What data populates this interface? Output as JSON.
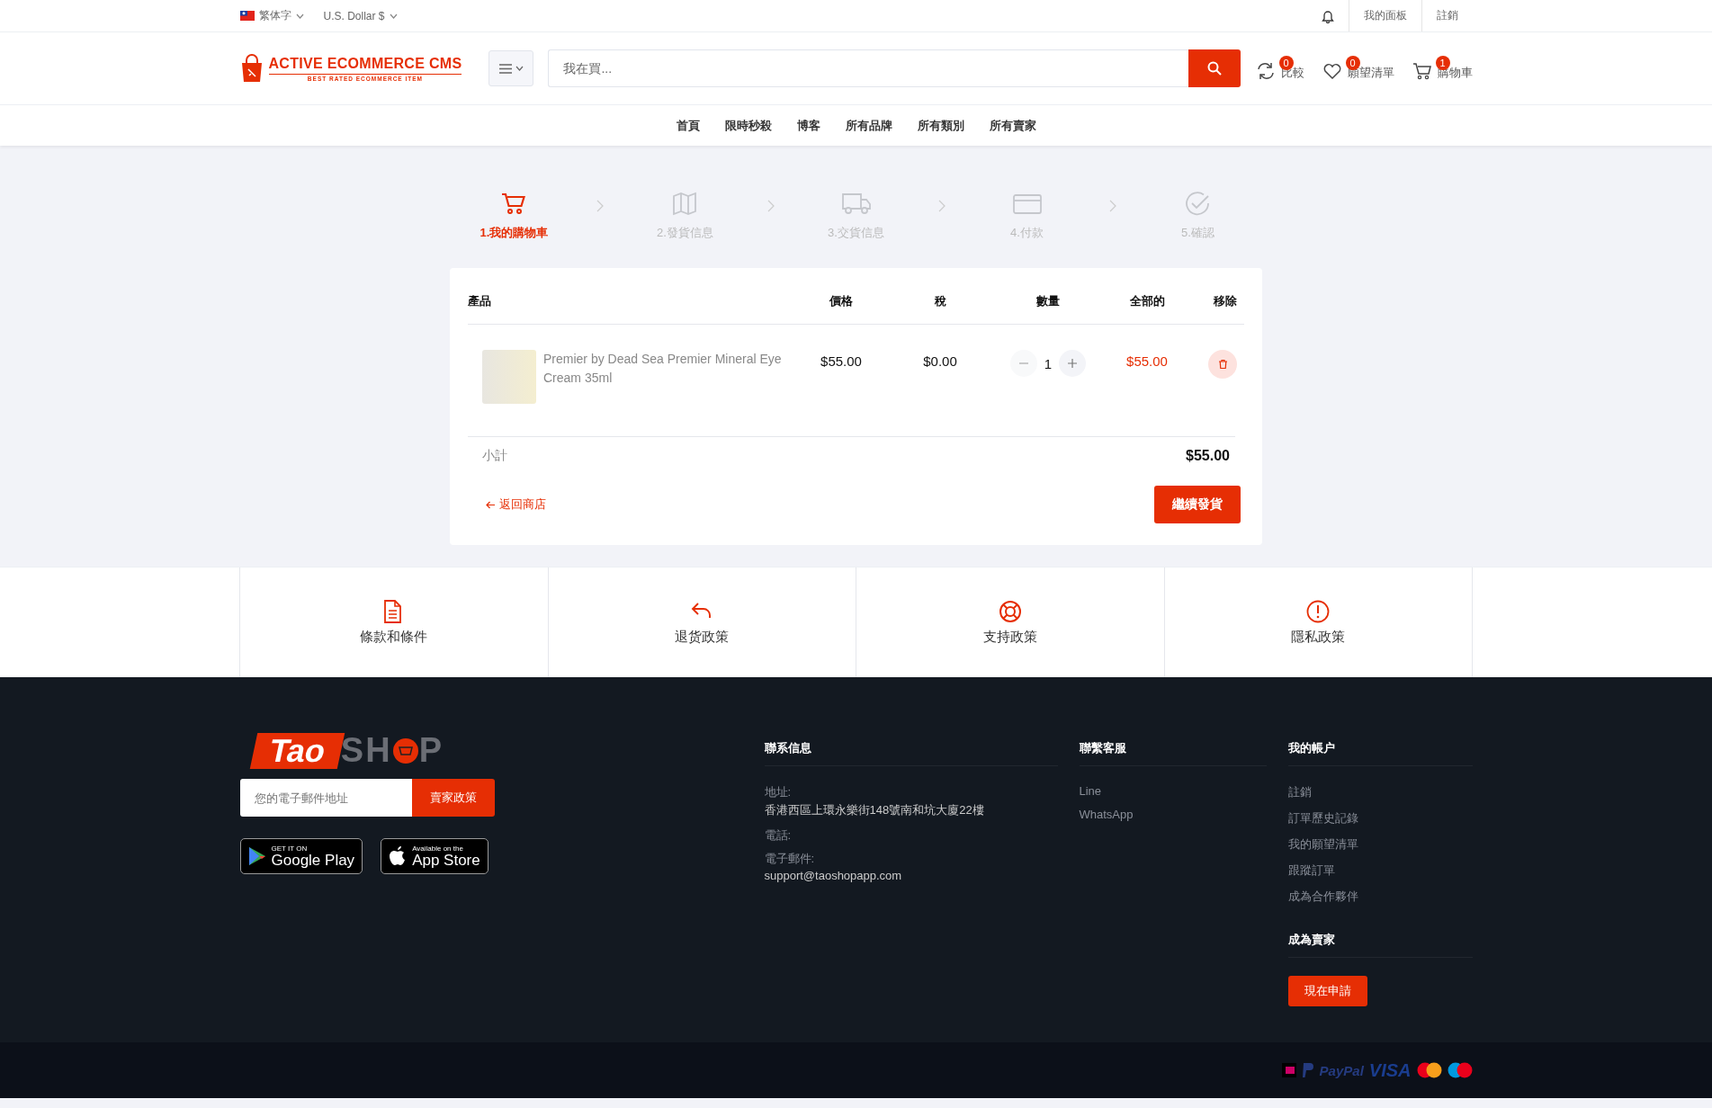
{
  "top_bar": {
    "language": "繁体字",
    "currency": "U.S. Dollar $",
    "links": [
      "我的面板",
      "註銷"
    ]
  },
  "header": {
    "logo": {
      "title": "ACTIVE ECOMMERCE CMS",
      "tagline": "BEST RATED ECOMMERCE ITEM"
    },
    "search": {
      "placeholder": "我在買..."
    },
    "actions": [
      {
        "kind": "compare",
        "count": "0",
        "label": "比較"
      },
      {
        "kind": "wishlist",
        "count": "0",
        "label": "願望清單"
      },
      {
        "kind": "cart",
        "count": "1",
        "label": "購物車"
      }
    ]
  },
  "nav": [
    "首頁",
    "限時秒殺",
    "博客",
    "所有品牌",
    "所有類別",
    "所有賣家"
  ],
  "steps": [
    {
      "kind": "cart",
      "label": "1.我的購物車",
      "selected": true
    },
    {
      "kind": "map",
      "label": "2.發貨信息",
      "selected": false
    },
    {
      "kind": "truck",
      "label": "3.交貨信息",
      "selected": false
    },
    {
      "kind": "card",
      "label": "4.付款",
      "selected": false
    },
    {
      "kind": "check",
      "label": "5.確認",
      "selected": false
    }
  ],
  "cart": {
    "columns": [
      "產品",
      "價格",
      "稅",
      "數量",
      "全部的",
      "移除"
    ],
    "rows": [
      {
        "product": "Premier by Dead Sea Premier Mineral Eye Cream 35ml",
        "price": "$55.00",
        "tax": "$0.00",
        "quantity": "1",
        "total": "$55.00"
      }
    ],
    "subtotal_label": "小計",
    "subtotal": "$55.00",
    "back_link": "返回商店",
    "continue_button": "繼續發貨"
  },
  "policies": [
    {
      "kind": "document",
      "label": "條款和條件"
    },
    {
      "kind": "return",
      "label": "退货政策"
    },
    {
      "kind": "support",
      "label": "支持政策"
    },
    {
      "kind": "alert",
      "label": "隱私政策"
    }
  ],
  "footer": {
    "logo": {
      "part_1": "Tao",
      "part_2": "SH",
      "part_3": "P"
    },
    "email": {
      "placeholder": "您的電子郵件地址"
    },
    "subscribe_button": "賣家政策",
    "apps": [
      {
        "kind": "google",
        "small": "GET IT ON",
        "big": "Google Play"
      },
      {
        "kind": "apple",
        "small": "Available on the",
        "big": "App Store"
      }
    ],
    "contact": {
      "title": "聯系信息",
      "fields": [
        {
          "label": "地址:",
          "value": "香港西區上環永樂街148號南和坑大廈22樓"
        },
        {
          "label": "電話:"
        },
        {
          "label": "電子郵件:",
          "value": "support@taoshopapp.com"
        }
      ]
    },
    "support": {
      "title": "聯繫客服",
      "links": [
        "Line",
        "WhatsApp"
      ]
    },
    "account": {
      "title": "我的帳户",
      "links": [
        "註銷",
        "訂單歷史記錄",
        "我的願望清單",
        "跟蹤訂單",
        "成為合作夥伴"
      ]
    },
    "seller": {
      "title": "成為賣家",
      "button": "現在申請"
    },
    "payments": [
      "PayPal",
      "VISA"
    ]
  }
}
